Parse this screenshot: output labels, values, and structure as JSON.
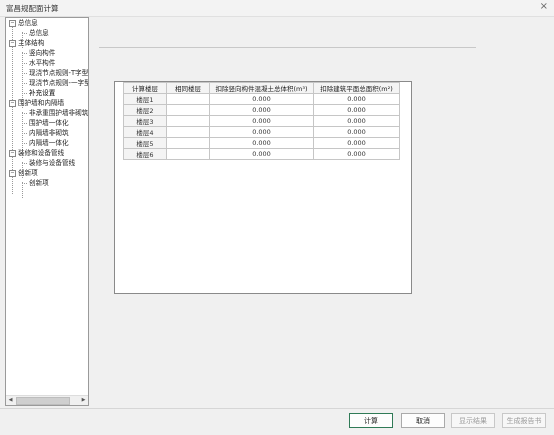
{
  "window": {
    "title": "富昌规配面计算",
    "close_glyph": "×"
  },
  "tree": {
    "scroll_left": "◀",
    "scroll_right": "▶",
    "groups": [
      {
        "label": "总信息",
        "children": [
          "总信息"
        ]
      },
      {
        "label": "主体结构",
        "children": [
          "竖向构件",
          "水平构件",
          "现浇节点规则-T字型",
          "现浇节点规则-一字型",
          "补充设置"
        ]
      },
      {
        "label": "围护墙和内隔墙",
        "children": [
          "非承重围护墙非砌筑",
          "围护墙一体化",
          "内隔墙非砌筑",
          "内隔墙一体化"
        ]
      },
      {
        "label": "装修和设备管线",
        "children": [
          "装修与设备管线"
        ]
      },
      {
        "label": "创新项",
        "children": [
          "创新项"
        ]
      }
    ]
  },
  "table": {
    "headers": [
      "计算楼层",
      "相同楼层",
      "扣除竖向构件混凝土总体积(m³)",
      "扣除建筑平面总面积(m²)"
    ],
    "rows": [
      [
        "楼层1",
        "",
        "0.000",
        "0.000"
      ],
      [
        "楼层2",
        "",
        "0.000",
        "0.000"
      ],
      [
        "楼层3",
        "",
        "0.000",
        "0.000"
      ],
      [
        "楼层4",
        "",
        "0.000",
        "0.000"
      ],
      [
        "楼层5",
        "",
        "0.000",
        "0.000"
      ],
      [
        "楼层6",
        "",
        "0.000",
        "0.000"
      ]
    ]
  },
  "buttons": {
    "calculate": "计算",
    "cancel": "取消",
    "show_result": "显示结果",
    "generate_report": "生成报告书"
  }
}
